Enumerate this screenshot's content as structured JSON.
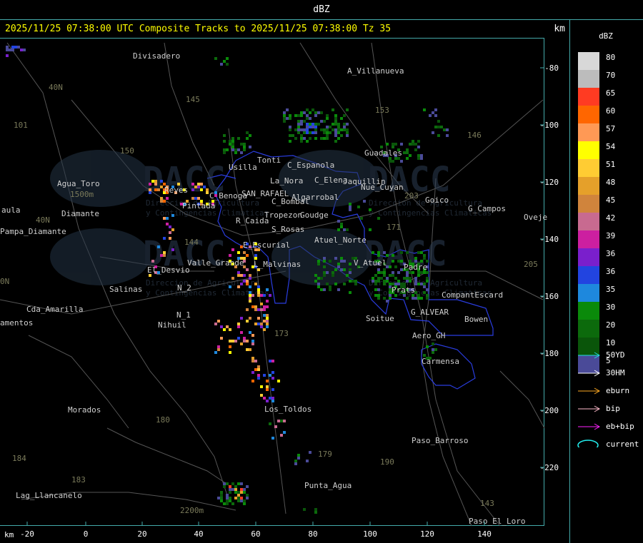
{
  "window": {
    "title": "dBZ"
  },
  "header": {
    "text": "2025/11/25 07:38:00 UTC Composite Tracks to 2025/11/25 07:38:00 Tz 35",
    "unit": "km"
  },
  "axes": {
    "x_unit": "km",
    "y_unit": "km",
    "x_ticks": [
      "-20",
      "0",
      "20",
      "40",
      "60",
      "80",
      "100",
      "120",
      "140"
    ],
    "y_ticks": [
      "-80",
      "-100",
      "-120",
      "-140",
      "-160",
      "-180",
      "-200",
      "-220"
    ]
  },
  "legend": {
    "title": "dBZ",
    "scale": [
      {
        "value": "80",
        "color": "#d8d8d8"
      },
      {
        "value": "70",
        "color": "#bcbcbc"
      },
      {
        "value": "65",
        "color": "#ff3b22"
      },
      {
        "value": "60",
        "color": "#ff6600"
      },
      {
        "value": "57",
        "color": "#ff9955"
      },
      {
        "value": "54",
        "color": "#ffff00"
      },
      {
        "value": "51",
        "color": "#ffcc33"
      },
      {
        "value": "48",
        "color": "#e5a02a"
      },
      {
        "value": "45",
        "color": "#d0843c"
      },
      {
        "value": "42",
        "color": "#c86a90"
      },
      {
        "value": "39",
        "color": "#cc1fa0"
      },
      {
        "value": "36",
        "color": "#7a1fcc"
      },
      {
        "value": "36",
        "color": "#2244e0"
      },
      {
        "value": "35",
        "color": "#1e88dd"
      },
      {
        "value": "30",
        "color": "#0a8a0a"
      },
      {
        "value": "20",
        "color": "#0c6a0c"
      },
      {
        "value": "10",
        "color": "#0a550a"
      },
      {
        "value": "5",
        "color": "#4a4a98"
      }
    ],
    "tracks": [
      {
        "label": "50YD",
        "color": "#22dddd"
      },
      {
        "label": "30HM",
        "color": "#ffffff"
      },
      {
        "label": "eburn",
        "color": "#ffaa22"
      },
      {
        "label": "bip",
        "color": "#ffbbcc"
      },
      {
        "label": "eb+bip",
        "color": "#ff22ff"
      }
    ],
    "current": {
      "label": "current",
      "color": "#22eeee"
    }
  },
  "places": [
    {
      "name": "Divisadero"
    },
    {
      "name": "A_Villanueva"
    },
    {
      "name": "40N"
    },
    {
      "name": "101"
    },
    {
      "name": "153"
    },
    {
      "name": "146"
    },
    {
      "name": "150"
    },
    {
      "name": "Guadales"
    },
    {
      "name": "Tonti"
    },
    {
      "name": "C_Espanola"
    },
    {
      "name": "Usilla"
    },
    {
      "name": "La_Nora"
    },
    {
      "name": "C_Elena"
    },
    {
      "name": "Jaquillin"
    },
    {
      "name": "Nue_Cuyan"
    },
    {
      "name": "Agua_Toro"
    },
    {
      "name": "1500m"
    },
    {
      "name": "Reyes"
    },
    {
      "name": "C_Benoga"
    },
    {
      "name": "SAN_RAFAEL"
    },
    {
      "name": "Algarrobal"
    },
    {
      "name": "C_Bombal"
    },
    {
      "name": "Goico"
    },
    {
      "name": "G_Campos"
    },
    {
      "name": "Oveje"
    },
    {
      "name": "aula"
    },
    {
      "name": "Pampa_Diamante"
    },
    {
      "name": "Pintada"
    },
    {
      "name": "R_Caida"
    },
    {
      "name": "Tropezon"
    },
    {
      "name": "Goudge"
    },
    {
      "name": "S_Rosas"
    },
    {
      "name": "Atuel_Norte"
    },
    {
      "name": "E_Escurial"
    },
    {
      "name": "V_Atuel"
    },
    {
      "name": "Padre"
    },
    {
      "name": "El_Desvio"
    },
    {
      "name": "Valle_Grande"
    },
    {
      "name": "L_Malvinas"
    },
    {
      "name": "Salinas"
    },
    {
      "name": "N_2"
    },
    {
      "name": "Prats"
    },
    {
      "name": "CompantEscard"
    },
    {
      "name": "Cda_Amarilla"
    },
    {
      "name": "N_1"
    },
    {
      "name": "Nihuil"
    },
    {
      "name": "Soitue"
    },
    {
      "name": "G_ALVEAR"
    },
    {
      "name": "Bowen"
    },
    {
      "name": "amentos"
    },
    {
      "name": "Aero_GH"
    },
    {
      "name": "Carmensa"
    },
    {
      "name": "Morados"
    },
    {
      "name": "Los_Toldos"
    },
    {
      "name": "184"
    },
    {
      "name": "180"
    },
    {
      "name": "179"
    },
    {
      "name": "Paso_Barroso"
    },
    {
      "name": "183"
    },
    {
      "name": "Punta_Agua"
    },
    {
      "name": "Lag_Llancanelo"
    },
    {
      "name": "2200m"
    },
    {
      "name": "Paso_El_Loro"
    },
    {
      "name": "143"
    },
    {
      "name": "205"
    },
    {
      "name": "203"
    },
    {
      "name": "171"
    },
    {
      "name": "190"
    },
    {
      "name": "40N-b"
    },
    {
      "name": "0N"
    },
    {
      "name": "Diamante"
    },
    {
      "name": "145"
    },
    {
      "name": "144"
    },
    {
      "name": "173"
    }
  ],
  "watermark": {
    "brand": "DACC",
    "line1": "Direccion de Agricultura",
    "line2": "y Contingencias Climaticas"
  }
}
